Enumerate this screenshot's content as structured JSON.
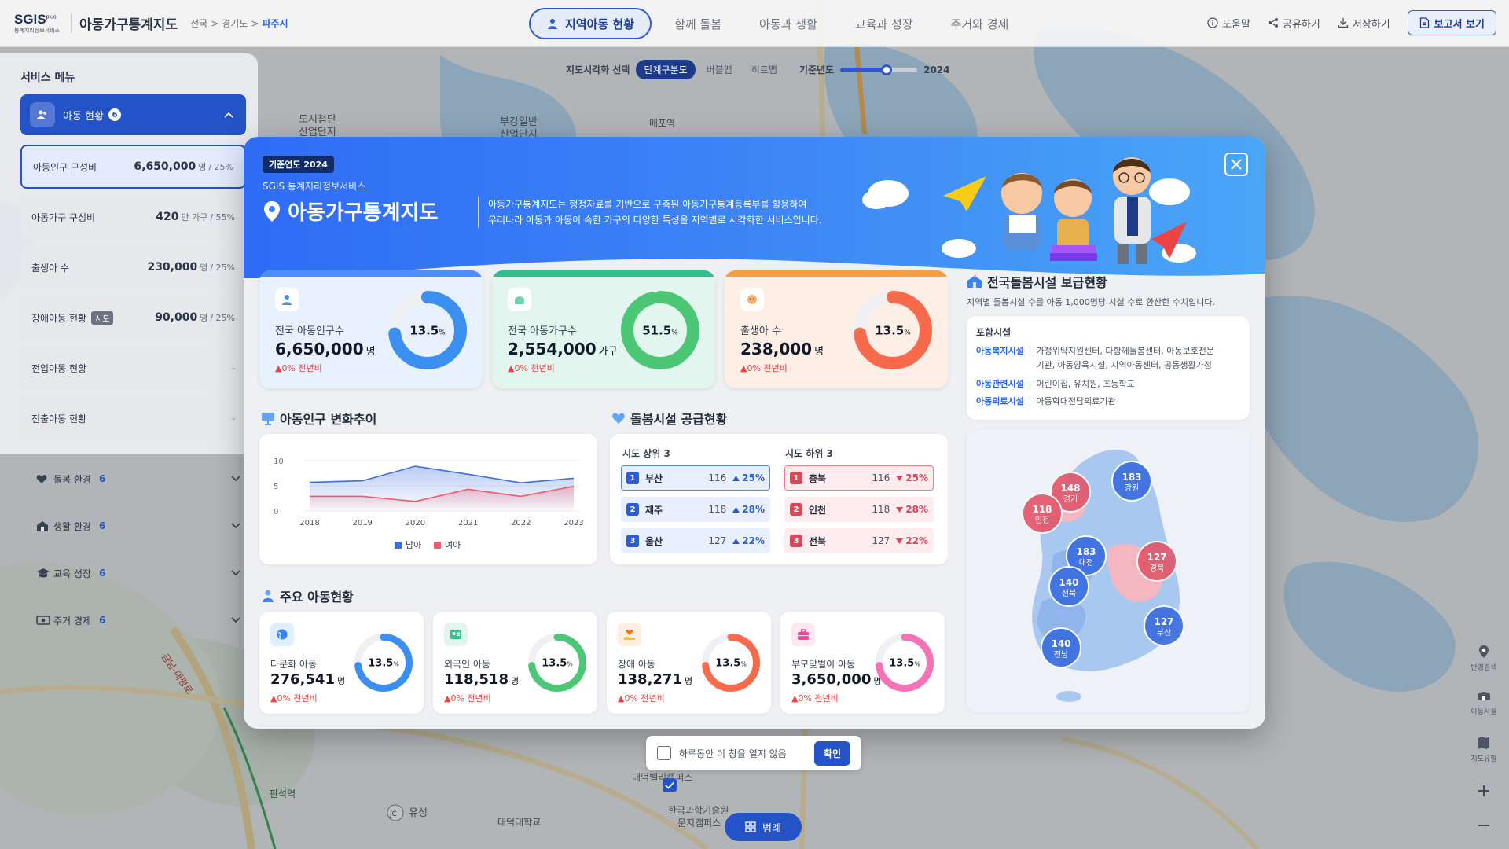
{
  "header": {
    "logo_text": "SGIS",
    "logo_plus": "plus",
    "logo_sub": "통계지리정보서비스",
    "app_title": "아동가구통계지도",
    "breadcrumb": [
      "전국",
      "경기도",
      "파주시"
    ],
    "nav": [
      "지역아동 현황",
      "함께 돌봄",
      "아동과 생활",
      "교육과 성장",
      "주거와 경제"
    ],
    "help": "도움말",
    "share": "공유하기",
    "save": "저장하기",
    "report": "보고서 보기"
  },
  "map_toolbar": {
    "label": "지도시각화 선택",
    "options": [
      "단계구분도",
      "버블맵",
      "히트맵"
    ],
    "selected": "단계구분도",
    "year_label": "기준년도",
    "year": "2024",
    "year_progress": 0.6
  },
  "map_labels": {
    "place1": "도시첨단",
    "place1b": "산업단지",
    "place2": "부강일반",
    "place2b": "산업단지",
    "station1": "매포역",
    "station2": "판석역",
    "place3": "유성",
    "place4": "대덕대학교",
    "place5": "한국과학기술원",
    "place5b": "문지캠퍼스",
    "place6": "대덕밸리캠퍼스",
    "road": "금남-대평로",
    "jc": "JC"
  },
  "sidebar": {
    "title": "서비스 메뉴",
    "active": {
      "label": "아동 현황",
      "count": "6"
    },
    "subs": [
      {
        "name": "아동인구 구성비",
        "value": "6,650,000",
        "unit": "명",
        "pct": "/ 25%",
        "tag": ""
      },
      {
        "name": "아동가구 구성비",
        "value": "420",
        "unit": "만 가구",
        "pct": "/ 55%",
        "tag": ""
      },
      {
        "name": "출생아 수",
        "value": "230,000",
        "unit": "명",
        "pct": "/ 25%",
        "tag": ""
      },
      {
        "name": "장애아동 현황",
        "value": "90,000",
        "unit": "명",
        "pct": "/ 25%",
        "tag": "시도"
      },
      {
        "name": "전입아동 현황",
        "value": "-",
        "unit": "",
        "pct": "",
        "tag": ""
      },
      {
        "name": "전출아동 현황",
        "value": "-",
        "unit": "",
        "pct": "",
        "tag": ""
      }
    ],
    "categories": [
      {
        "label": "돌봄 환경",
        "count": "6",
        "icon": "heart-icon"
      },
      {
        "label": "생활 환경",
        "count": "6",
        "icon": "building-icon"
      },
      {
        "label": "교육 성장",
        "count": "6",
        "icon": "graduation-cap-icon"
      },
      {
        "label": "주거 경제",
        "count": "6",
        "icon": "money-icon"
      }
    ]
  },
  "right_tools": [
    "반경검색",
    "아동시설",
    "지도유형"
  ],
  "modal": {
    "year_badge": "기준연도 2024",
    "sgis_sub": "SGIS 통계지리정보서비스",
    "title": "아동가구통계지도",
    "desc1": "아동가구통계지도는 행정자료를 기반으로 구축된 아동가구통계등록부를 활용하여",
    "desc2": "우리나라 아동과 아동이 속한 가구의 다양한 특성을 지역별로 시각화한 서비스입니다.",
    "kpis": [
      {
        "label": "전국 아동인구수",
        "value": "6,650,000",
        "unit": "명",
        "pct": 13.5,
        "change": "0% 전년비",
        "color": "#3b8ff0",
        "bg": "#e8f1fe",
        "strip": "#4c8ef7",
        "icon": "person-icon"
      },
      {
        "label": "전국 아동가구수",
        "value": "2,554,000",
        "unit": "가구",
        "pct": 51.5,
        "change": "0% 전년비",
        "color": "#4cc776",
        "bg": "#e3f5ef",
        "strip": "#2fbf8c",
        "icon": "house-icon"
      },
      {
        "label": "출생아 수",
        "value": "238,000",
        "unit": "명",
        "pct": 13.5,
        "change": "0% 전년비",
        "color": "#f76b4c",
        "bg": "#fdeee6",
        "strip": "#f59e42",
        "icon": "baby-icon"
      }
    ],
    "trend": {
      "title": "아동인구 변화추이",
      "legend_male": "남아",
      "legend_female": "여아"
    },
    "supply": {
      "title": "돌봄시설 공급현황",
      "top_title": "시도 상위 3",
      "bottom_title": "시도 하위 3",
      "top": [
        {
          "rank": "1",
          "name": "부산",
          "count": "116",
          "pct": "25%"
        },
        {
          "rank": "2",
          "name": "제주",
          "count": "118",
          "pct": "28%"
        },
        {
          "rank": "3",
          "name": "울산",
          "count": "127",
          "pct": "22%"
        }
      ],
      "bottom": [
        {
          "rank": "1",
          "name": "충북",
          "count": "116",
          "pct": "25%"
        },
        {
          "rank": "2",
          "name": "인천",
          "count": "118",
          "pct": "28%"
        },
        {
          "rank": "3",
          "name": "전북",
          "count": "127",
          "pct": "22%"
        }
      ]
    },
    "status": {
      "title": "주요 아동현황",
      "cards": [
        {
          "label": "다문화 아동",
          "value": "276,541",
          "unit": "명",
          "pct": 13.5,
          "change": "0% 전년비",
          "color": "#3b8ff0",
          "icon": "globe-icon",
          "icon_bg": "#e3eefc"
        },
        {
          "label": "외국인 아동",
          "value": "118,518",
          "unit": "명",
          "pct": 13.5,
          "change": "0% 전년비",
          "color": "#4cc776",
          "icon": "id-card-icon",
          "icon_bg": "#e2f5ec"
        },
        {
          "label": "장애 아동",
          "value": "138,271",
          "unit": "명",
          "pct": 13.5,
          "change": "0% 전년비",
          "color": "#f76b4c",
          "icon": "hand-heart-icon",
          "icon_bg": "#fdeedf"
        },
        {
          "label": "부모맞벌이 아동",
          "value": "3,650,000",
          "unit": "명",
          "pct": 13.5,
          "change": "0% 전년비",
          "color": "#f472b6",
          "icon": "briefcase-icon",
          "icon_bg": "#fde8f1"
        }
      ]
    },
    "facilities": {
      "title": "전국돌봄시설 보급현황",
      "subtitle": "지역별 돌봄시설 수를 아동 1,000명당 시설 수로 환산한 수치입니다.",
      "include_title": "포함시설",
      "rows": [
        {
          "k": "아동복지시설",
          "v1": "가정위탁지원센터, 다함께돌봄센터, 아동보호전문",
          "v2": "기관, 아동양육시설, 지역아동센터, 공동생활가정"
        },
        {
          "k": "아동관련시설",
          "v1": "어린이집, 유치원, 초등학교",
          "v2": ""
        },
        {
          "k": "아동의료시설",
          "v1": "아동학대전담의료기관",
          "v2": ""
        }
      ],
      "bubbles": [
        {
          "value": "148",
          "name": "경기",
          "tone": "red"
        },
        {
          "value": "183",
          "name": "강원",
          "tone": "blue"
        },
        {
          "value": "118",
          "name": "인천",
          "tone": "red"
        },
        {
          "value": "183",
          "name": "대전",
          "tone": "blue"
        },
        {
          "value": "127",
          "name": "경북",
          "tone": "red"
        },
        {
          "value": "140",
          "name": "전북",
          "tone": "blue"
        },
        {
          "value": "127",
          "name": "부산",
          "tone": "blue"
        },
        {
          "value": "140",
          "name": "전남",
          "tone": "blue"
        }
      ]
    }
  },
  "chart_data": {
    "type": "area",
    "categories": [
      "2018",
      "2019",
      "2020",
      "2021",
      "2022",
      "2023"
    ],
    "series": [
      {
        "name": "남아",
        "values": [
          5.7,
          6.0,
          8.9,
          7.3,
          5.6,
          6.5
        ],
        "color": "#3b6fe0"
      },
      {
        "name": "여아",
        "values": [
          2.9,
          2.9,
          1.9,
          4.3,
          2.9,
          4.9
        ],
        "color": "#ef5b6b"
      }
    ],
    "ylim": [
      0,
      10
    ],
    "yticks": [
      "10",
      "5",
      "0"
    ],
    "grid": true,
    "legend_position": "bottom"
  },
  "footer": {
    "dont_show": "하루동안 이 창을 열지 않음",
    "ok": "확인",
    "legend": "범례"
  }
}
